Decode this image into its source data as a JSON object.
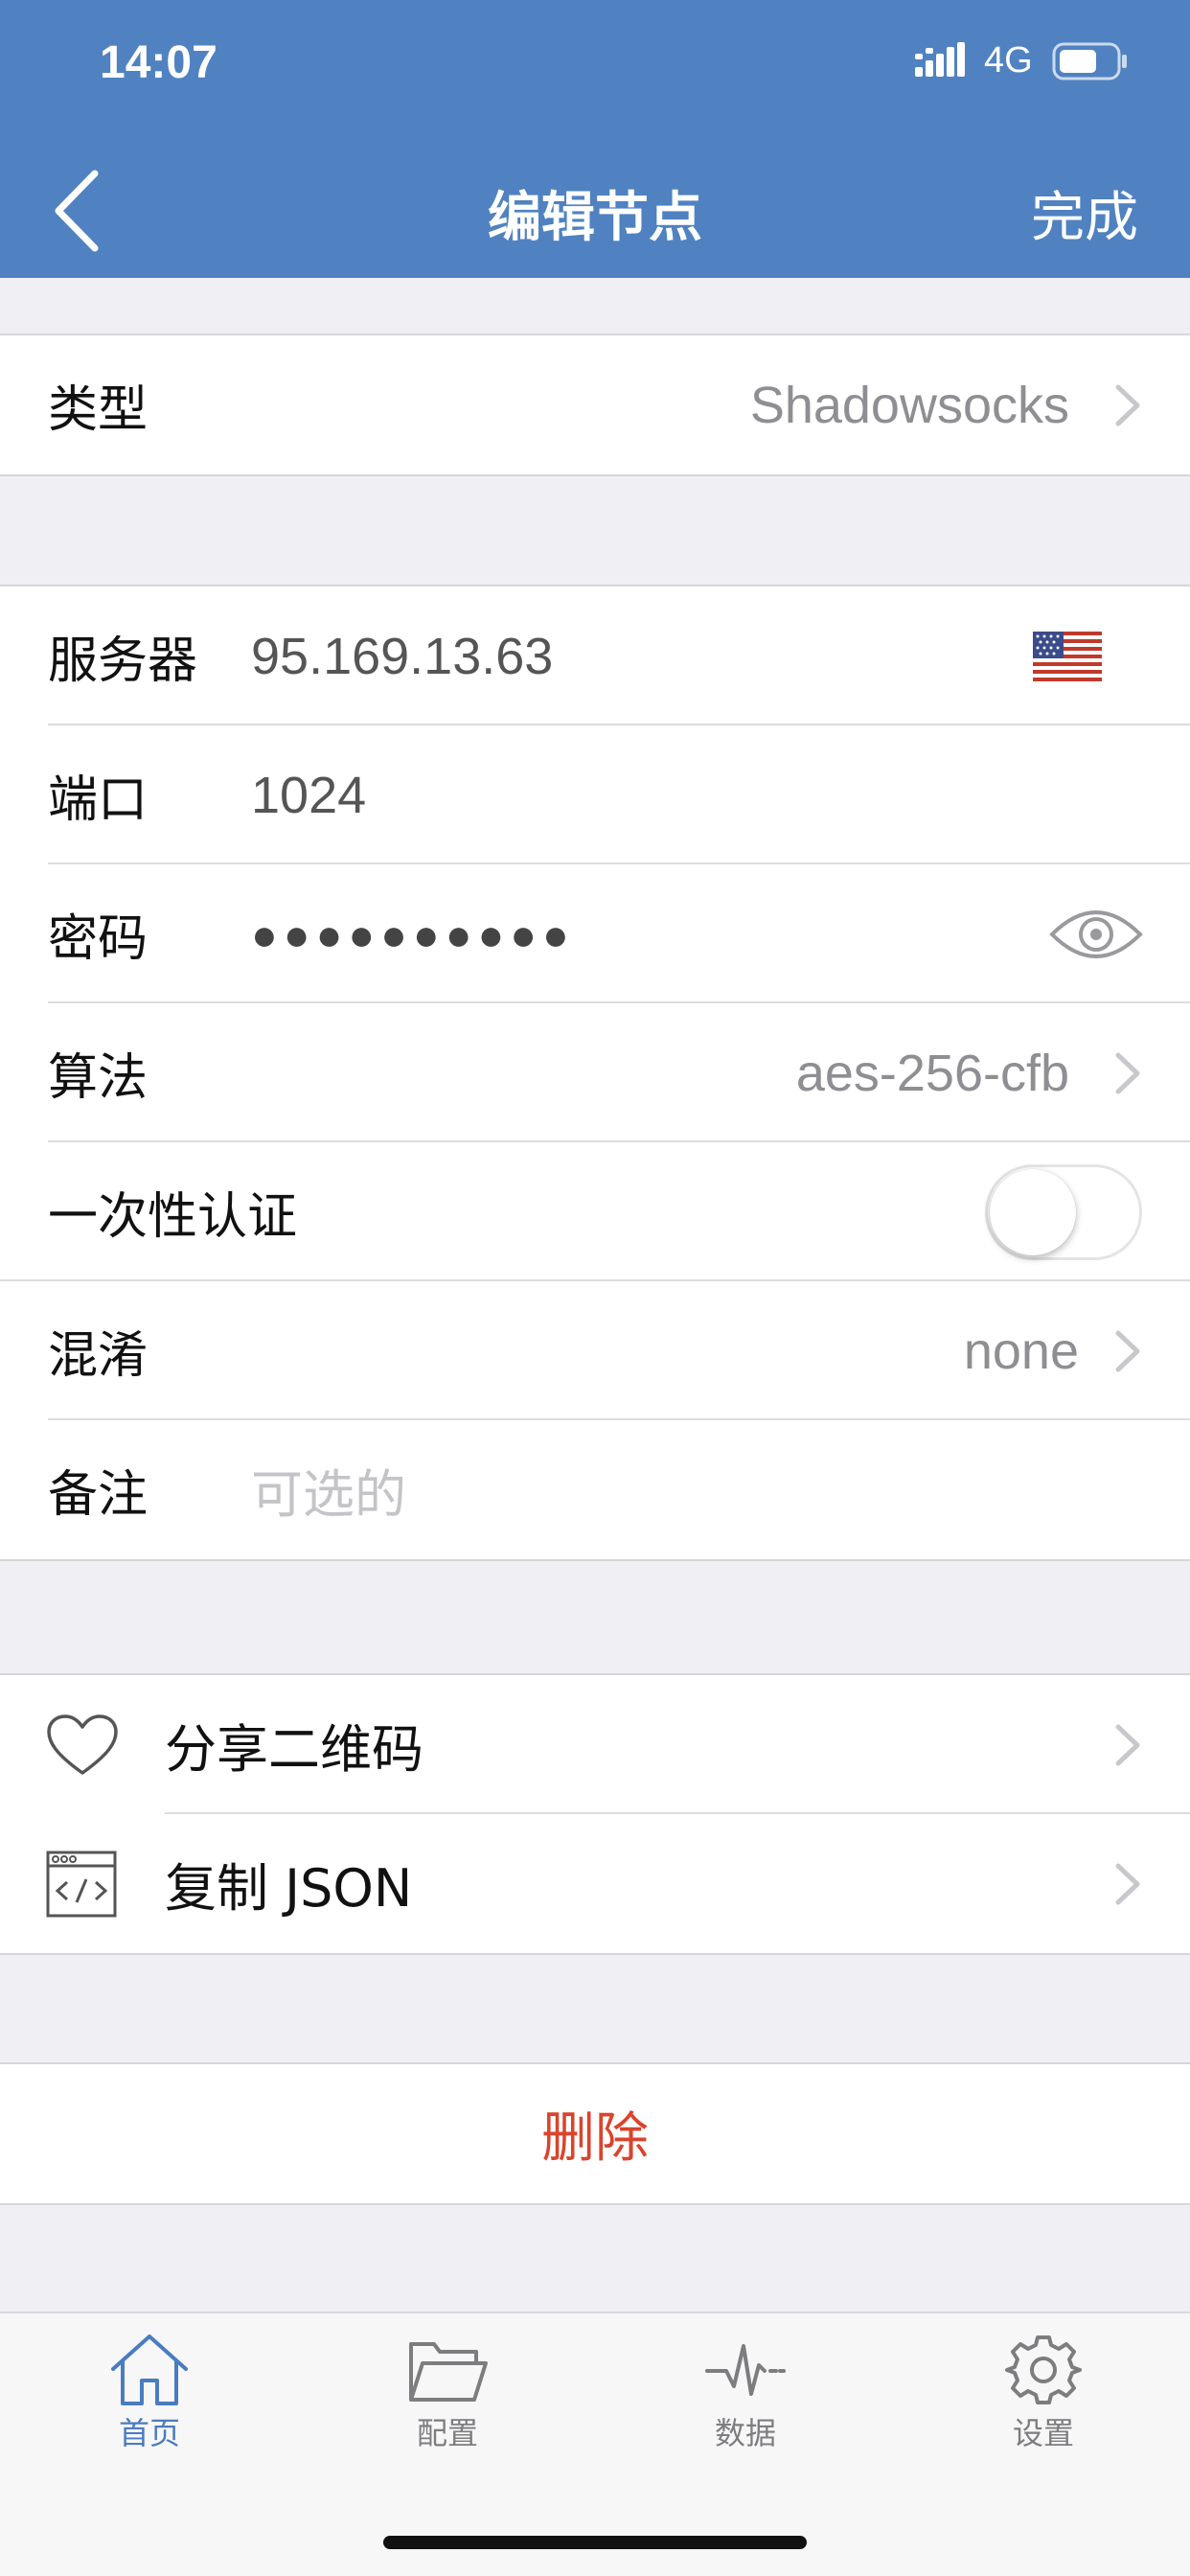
{
  "status_bar": {
    "time": "14:07",
    "network": "4G"
  },
  "nav": {
    "title": "编辑节点",
    "done_label": "完成"
  },
  "type_row": {
    "label": "类型",
    "value": "Shadowsocks"
  },
  "server": {
    "server_label": "服务器",
    "server_value": "95.169.13.63",
    "port_label": "端口",
    "port_value": "1024",
    "password_label": "密码",
    "password_mask": "●●●●●●●●●●",
    "algorithm_label": "算法",
    "algorithm_value": "aes-256-cfb",
    "ota_label": "一次性认证",
    "ota_enabled": false,
    "obfs_label": "混淆",
    "obfs_value": "none",
    "remark_label": "备注",
    "remark_placeholder": "可选的"
  },
  "actions": [
    {
      "label": "分享二维码",
      "icon": "heart-icon"
    },
    {
      "label": "复制 JSON",
      "icon": "code-window-icon"
    }
  ],
  "delete_label": "删除",
  "tabs": [
    {
      "label": "首页",
      "icon": "home-icon",
      "active": true
    },
    {
      "label": "配置",
      "icon": "folder-icon",
      "active": false
    },
    {
      "label": "数据",
      "icon": "pulse-icon",
      "active": false
    },
    {
      "label": "设置",
      "icon": "gear-icon",
      "active": false
    }
  ],
  "colors": {
    "nav_bar": "#5082c1",
    "active_tab": "#4a7cc0",
    "destructive": "#d9442d",
    "background": "#efeff4"
  }
}
